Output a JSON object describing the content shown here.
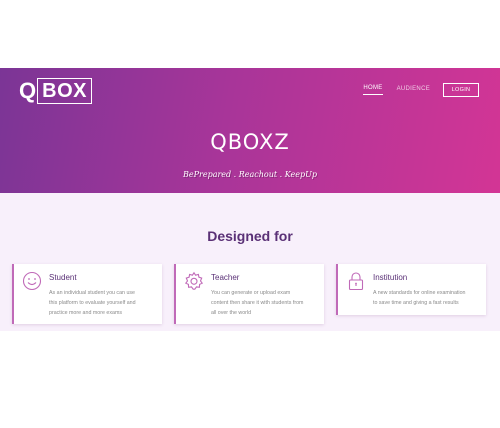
{
  "logo": {
    "q": "Q",
    "box": "BOX"
  },
  "nav": {
    "items": [
      {
        "label": "HOME",
        "active": true
      },
      {
        "label": "AUDIENCE",
        "active": false
      }
    ],
    "login_label": "LOGIN"
  },
  "hero": {
    "title": "QBOXZ",
    "tagline": "BePrepared . Reachout . KeepUp"
  },
  "features": {
    "title": "Designed for",
    "cards": [
      {
        "icon": "smiley-icon",
        "title": "Student",
        "desc_lines": [
          "As an individual student you can use",
          "this platform to evaluate yourself and",
          "practice more and more exams"
        ]
      },
      {
        "icon": "gear-icon",
        "title": "Teacher",
        "desc_lines": [
          "You can generate or upload exam",
          "content then share it with students from",
          "all over the world"
        ]
      },
      {
        "icon": "lock-icon",
        "title": "Institution",
        "desc_lines": [
          "A new standards for online examination",
          "to save time and giving a fast results"
        ]
      }
    ]
  },
  "colors": {
    "gradient_start": "#7b3596",
    "gradient_end": "#d33595",
    "accent": "#c06ab8",
    "section_bg": "#f8f0fb",
    "heading": "#5a3076"
  }
}
